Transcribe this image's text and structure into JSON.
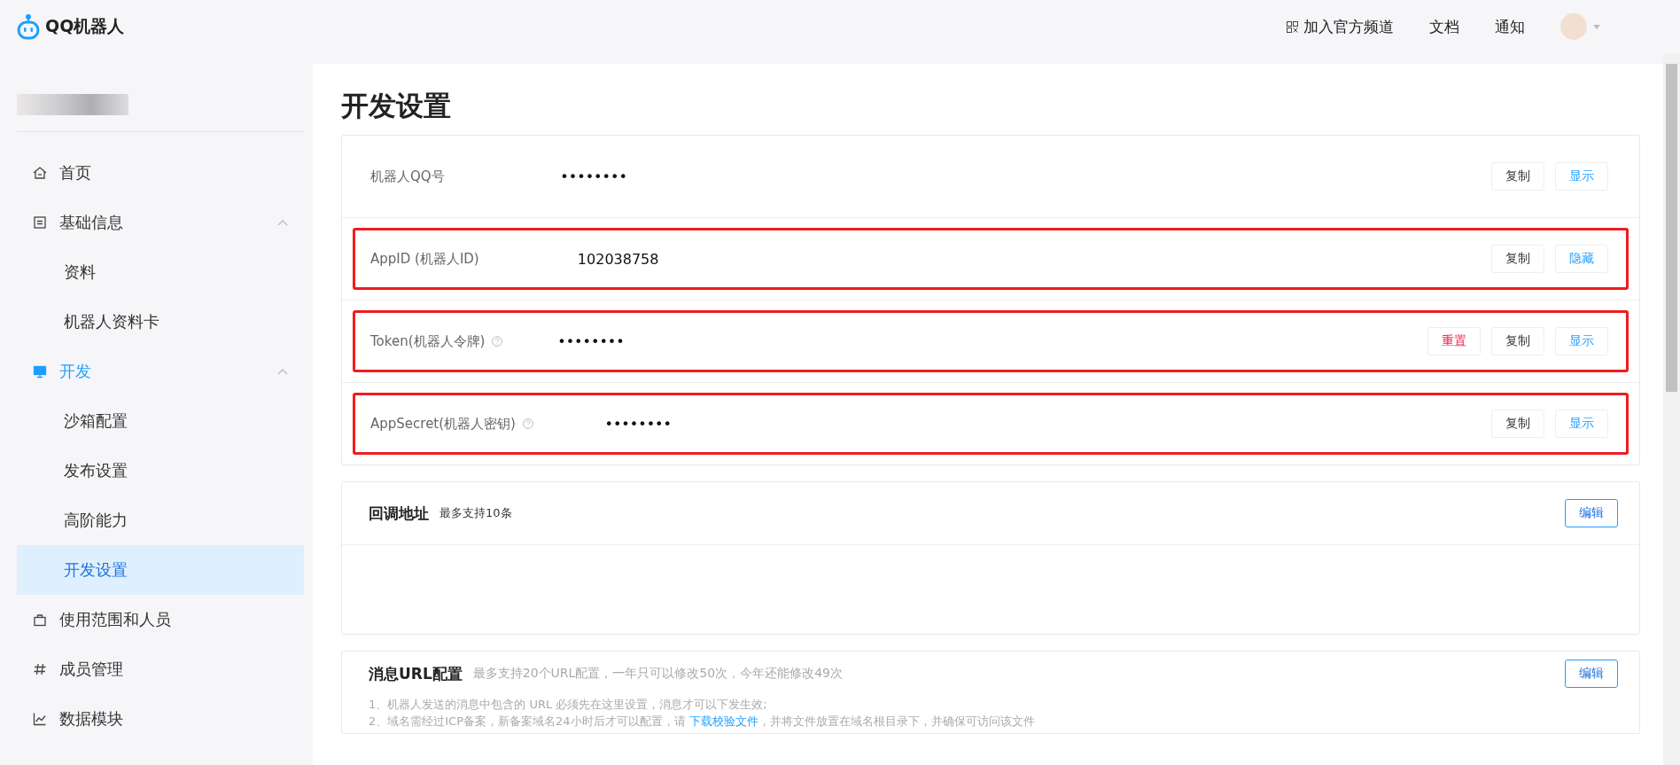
{
  "header": {
    "logo_text": "QQ机器人",
    "nav": [
      {
        "label": "加入官方频道",
        "icon": true
      },
      {
        "label": "文档",
        "icon": false
      },
      {
        "label": "通知",
        "icon": false
      }
    ]
  },
  "sidebar": {
    "items": [
      {
        "label": "首页",
        "selected": false
      },
      {
        "label": "基础信息",
        "selected": false,
        "expanded": true,
        "children": [
          {
            "label": "资料",
            "selected": false
          },
          {
            "label": "机器人资料卡",
            "selected": false
          }
        ]
      },
      {
        "label": "开发",
        "selected": true,
        "expanded": true,
        "children": [
          {
            "label": "沙箱配置",
            "selected": false
          },
          {
            "label": "发布设置",
            "selected": false
          },
          {
            "label": "高阶能力",
            "selected": false
          },
          {
            "label": "开发设置",
            "selected": true
          }
        ]
      },
      {
        "label": "使用范围和人员",
        "selected": false
      },
      {
        "label": "成员管理",
        "selected": false
      },
      {
        "label": "数据模块",
        "selected": false
      }
    ]
  },
  "page": {
    "title": "开发设置",
    "credentials": [
      {
        "label": "机器人QQ号",
        "help": false,
        "value": "••••••••",
        "highlighted": false,
        "buttons": [
          {
            "label": "复制",
            "kind": "default"
          },
          {
            "label": "显示",
            "kind": "primary"
          }
        ]
      },
      {
        "label": "AppID (机器人ID)",
        "help": false,
        "value": "102038758",
        "highlighted": true,
        "buttons": [
          {
            "label": "复制",
            "kind": "default"
          },
          {
            "label": "隐藏",
            "kind": "primary"
          }
        ]
      },
      {
        "label": "Token(机器人令牌)",
        "help": true,
        "value": "••••••••",
        "highlighted": true,
        "buttons": [
          {
            "label": "重置",
            "kind": "danger"
          },
          {
            "label": "复制",
            "kind": "default"
          },
          {
            "label": "显示",
            "kind": "primary"
          }
        ]
      },
      {
        "label": "AppSecret(机器人密钥)",
        "help": true,
        "value": "••••••••",
        "highlighted": true,
        "buttons": [
          {
            "label": "复制",
            "kind": "default"
          },
          {
            "label": "显示",
            "kind": "primary"
          }
        ]
      }
    ],
    "sections": [
      {
        "title": "回调地址",
        "note": "最多支持10条",
        "button": "编辑"
      },
      {
        "title": "消息URL配置",
        "note": "最多支持20个URL配置，一年只可以修改50次，今年还能修改49次",
        "button": "编辑",
        "lines": [
          "1、机器人发送的消息中包含的 URL 必须先在这里设置，消息才可以下发生效;",
          "2、域名需经过ICP备案，新备案域名24小时后才可以配置，请 **下载校验文件**，并将文件放置在域名根目录下，并确保可访问该文件"
        ]
      }
    ]
  }
}
